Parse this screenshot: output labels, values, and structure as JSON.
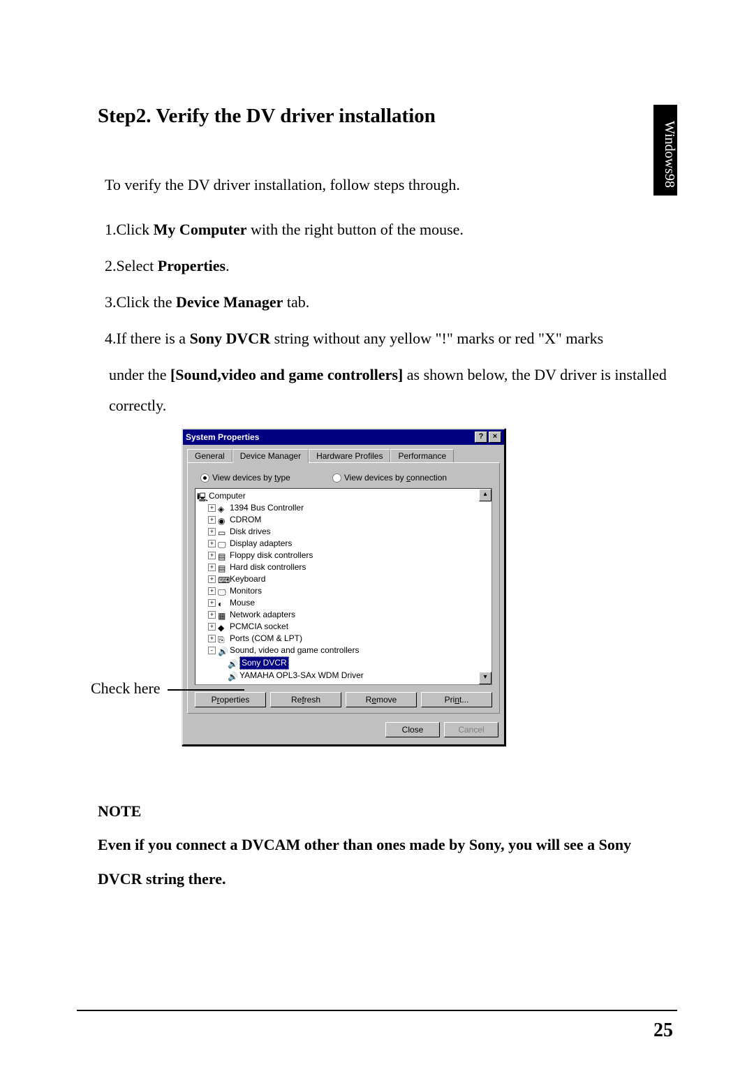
{
  "side_tab": "Windows98",
  "heading": "Step2. Verify the DV driver installation",
  "intro": "To verify the DV driver installation, follow steps through.",
  "steps": {
    "s1_a": "1.Click ",
    "s1_b": "My Computer",
    "s1_c": " with the right button of the mouse.",
    "s2_a": "2.Select ",
    "s2_b": "Properties",
    "s2_c": ".",
    "s3_a": "3.Click the ",
    "s3_b": "Device Manager",
    "s3_c": " tab.",
    "s4_a": "4.If there is a ",
    "s4_b": "Sony DVCR",
    "s4_c": " string without any yellow \"!\" marks or red \"X\" marks",
    "s4_d": "under the ",
    "s4_e": "[Sound,video and game controllers]",
    "s4_f": "  as shown below, the DV driver is installed correctly."
  },
  "check_label": "Check here",
  "dialog": {
    "title": "System Properties",
    "help": "?",
    "close": "×",
    "tabs": {
      "general": "General",
      "devmgr": "Device Manager",
      "hwprof": "Hardware Profiles",
      "perf": "Performance"
    },
    "radios": {
      "by_type_pre": "View devices by ",
      "by_type_u": "t",
      "by_type_post": "ype",
      "by_conn_pre": "View devices by ",
      "by_conn_u": "c",
      "by_conn_post": "onnection"
    },
    "tree": {
      "root": "Computer",
      "items": [
        "1394 Bus Controller",
        "CDROM",
        "Disk drives",
        "Display adapters",
        "Floppy disk controllers",
        "Hard disk controllers",
        "Keyboard",
        "Monitors",
        "Mouse",
        "Network adapters",
        "PCMCIA socket",
        "Ports (COM & LPT)",
        "Sound, video and game controllers"
      ],
      "sub": {
        "sony": "Sony DVCR",
        "yamaha": "YAMAHA OPL3-SAx WDM Driver"
      }
    },
    "buttons": {
      "properties": "Properties",
      "refresh": "Refresh",
      "remove": "Remove",
      "print": "Print...",
      "close": "Close",
      "cancel": "Cancel"
    },
    "u": {
      "properties": "r",
      "refresh": "f",
      "remove": "e",
      "print": "n"
    }
  },
  "note": {
    "title": "NOTE",
    "body": "Even if you connect a DVCAM other than ones made by Sony, you will see a Sony DVCR string there."
  },
  "page_number": "25"
}
